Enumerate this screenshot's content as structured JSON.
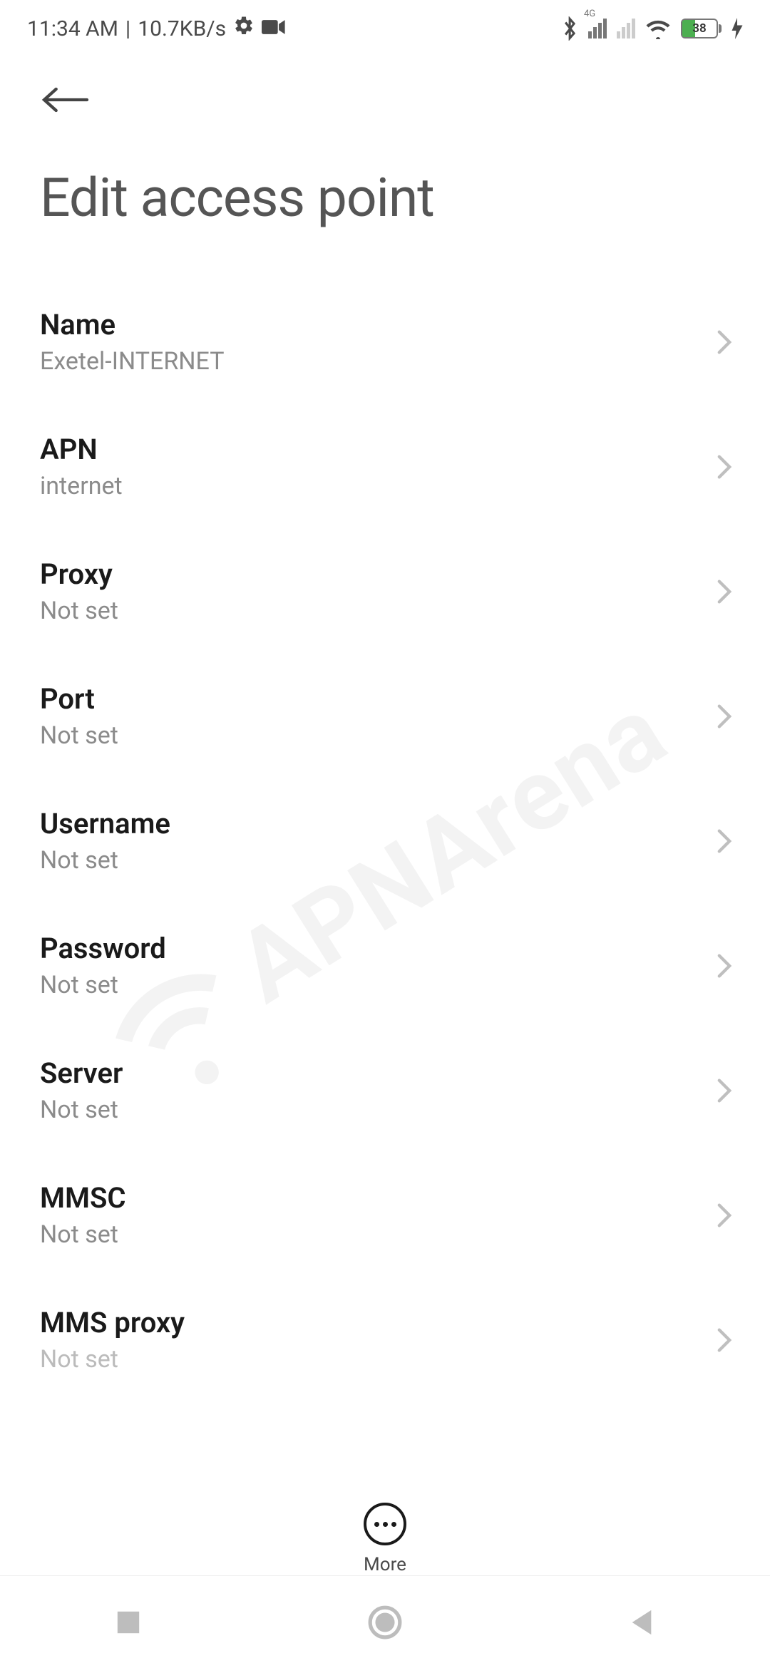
{
  "status": {
    "time": "11:34 AM",
    "divider": "|",
    "speed": "10.7KB/s",
    "battery_percent": "38",
    "battery_fill_width": "38%",
    "signal_label": "4G"
  },
  "page": {
    "title": "Edit access point"
  },
  "rows": [
    {
      "key": "name",
      "label": "Name",
      "value": "Exetel-INTERNET"
    },
    {
      "key": "apn",
      "label": "APN",
      "value": "internet"
    },
    {
      "key": "proxy",
      "label": "Proxy",
      "value": "Not set"
    },
    {
      "key": "port",
      "label": "Port",
      "value": "Not set"
    },
    {
      "key": "username",
      "label": "Username",
      "value": "Not set"
    },
    {
      "key": "password",
      "label": "Password",
      "value": "Not set"
    },
    {
      "key": "server",
      "label": "Server",
      "value": "Not set"
    },
    {
      "key": "mmsc",
      "label": "MMSC",
      "value": "Not set"
    },
    {
      "key": "mmsproxy",
      "label": "MMS proxy",
      "value": "Not set"
    }
  ],
  "bottom": {
    "more_label": "More"
  },
  "watermark_text": "APNArena"
}
